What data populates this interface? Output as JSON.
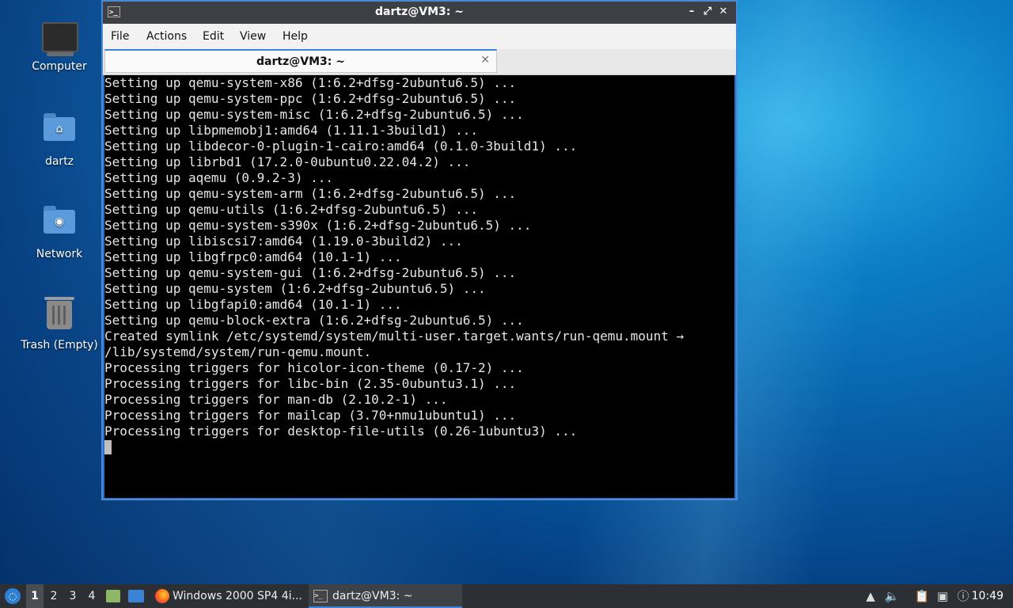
{
  "desktop": {
    "icons": [
      {
        "label": "Computer"
      },
      {
        "label": "dartz"
      },
      {
        "label": "Network"
      },
      {
        "label": "Trash (Empty)"
      }
    ]
  },
  "window": {
    "title": "dartz@VM3: ~",
    "menu": [
      "File",
      "Actions",
      "Edit",
      "View",
      "Help"
    ],
    "tab_label": "dartz@VM3: ~",
    "terminal_lines": [
      "Setting up qemu-system-x86 (1:6.2+dfsg-2ubuntu6.5) ...",
      "Setting up qemu-system-ppc (1:6.2+dfsg-2ubuntu6.5) ...",
      "Setting up qemu-system-misc (1:6.2+dfsg-2ubuntu6.5) ...",
      "Setting up libpmemobj1:amd64 (1.11.1-3build1) ...",
      "Setting up libdecor-0-plugin-1-cairo:amd64 (0.1.0-3build1) ...",
      "Setting up librbd1 (17.2.0-0ubuntu0.22.04.2) ...",
      "Setting up aqemu (0.9.2-3) ...",
      "Setting up qemu-system-arm (1:6.2+dfsg-2ubuntu6.5) ...",
      "Setting up qemu-utils (1:6.2+dfsg-2ubuntu6.5) ...",
      "Setting up qemu-system-s390x (1:6.2+dfsg-2ubuntu6.5) ...",
      "Setting up libiscsi7:amd64 (1.19.0-3build2) ...",
      "Setting up libgfrpc0:amd64 (10.1-1) ...",
      "Setting up qemu-system-gui (1:6.2+dfsg-2ubuntu6.5) ...",
      "Setting up qemu-system (1:6.2+dfsg-2ubuntu6.5) ...",
      "Setting up libgfapi0:amd64 (10.1-1) ...",
      "Setting up qemu-block-extra (1:6.2+dfsg-2ubuntu6.5) ...",
      "Created symlink /etc/systemd/system/multi-user.target.wants/run-qemu.mount →",
      "/lib/systemd/system/run-qemu.mount.",
      "Processing triggers for hicolor-icon-theme (0.17-2) ...",
      "Processing triggers for libc-bin (2.35-0ubuntu3.1) ...",
      "Processing triggers for man-db (2.10.2-1) ...",
      "Processing triggers for mailcap (3.70+nmu1ubuntu1) ...",
      "Processing triggers for desktop-file-utils (0.26-1ubuntu3) ..."
    ]
  },
  "taskbar": {
    "workspaces": [
      "1",
      "2",
      "3",
      "4"
    ],
    "tasks": [
      {
        "label": "Windows 2000 SP4 4i..."
      },
      {
        "label": "dartz@VM3: ~"
      }
    ],
    "clock": "10:49"
  }
}
